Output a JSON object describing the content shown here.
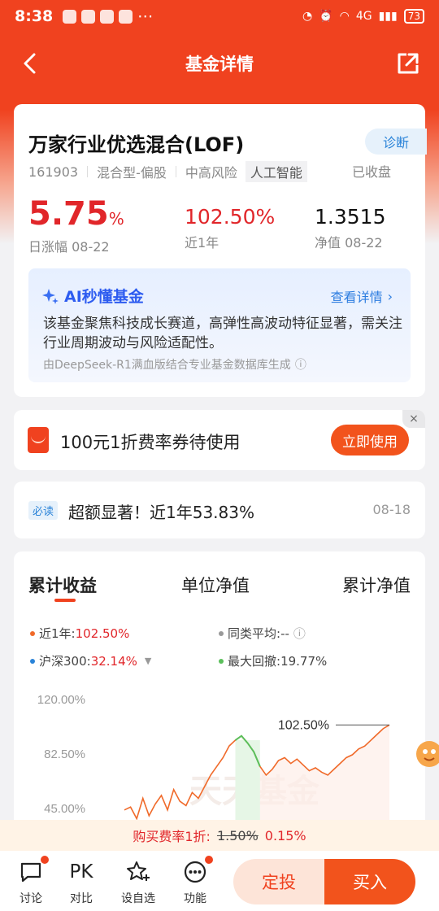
{
  "status_bar": {
    "time": "8:38",
    "network": "4G",
    "battery": "73"
  },
  "header": {
    "title": "基金详情"
  },
  "fund": {
    "name": "万家行业优选混合(LOF)",
    "diagnose_label": "诊断",
    "code": "161903",
    "type": "混合型-偏股",
    "risk": "中高风险",
    "theme": "人工智能",
    "market_status": "已收盘",
    "daily_change": "5.75",
    "daily_change_unit": "%",
    "daily_change_label": "日涨幅 08-22",
    "one_year_return": "102.50%",
    "one_year_label": "近1年",
    "nav": "1.3515",
    "nav_label": "净值 08-22"
  },
  "ai": {
    "title": "AI秒懂基金",
    "more": "查看详情",
    "description": "该基金聚焦科技成长赛道，高弹性高波动特征显著，需关注行业周期波动与风险适配性。",
    "source": "由DeepSeek-R1满血版结合专业基金数据库生成"
  },
  "coupon": {
    "text": "100元1折费率券待使用",
    "button": "立即使用",
    "close": "×"
  },
  "news": {
    "badge": "必读",
    "text": "超额显著！近1年53.83%",
    "date": "08-18"
  },
  "chart_tabs": [
    "累计收益",
    "单位净值",
    "累计净值"
  ],
  "legend": {
    "fund_label": "近1年:",
    "fund_value": "102.50%",
    "avg_label": "同类平均:",
    "avg_value": "--",
    "index_label": "沪深300:",
    "index_value": "32.14%",
    "drawdown_label": "最大回撤:",
    "drawdown_value": "19.77%"
  },
  "chart_data": {
    "type": "line",
    "y_ticks": [
      "120.00%",
      "82.50%",
      "45.00%"
    ],
    "ylim": [
      45.0,
      120.0
    ],
    "end_label": "102.50%",
    "watermark": "天天基金",
    "series": [
      {
        "name": "近1年",
        "color": "#f06a2a",
        "values": [
          44,
          46,
          38,
          52,
          40,
          48,
          54,
          44,
          58,
          50,
          47,
          56,
          52,
          60,
          68,
          74,
          80,
          88,
          92,
          95,
          90,
          84,
          74,
          68,
          72,
          78,
          80,
          76,
          79,
          75,
          71,
          73,
          70,
          68,
          72,
          76,
          80,
          82,
          86,
          88,
          92,
          96,
          100,
          102.5
        ]
      }
    ],
    "drawdown_segment": [
      18,
      22
    ]
  },
  "fee_bar": {
    "label": "购买费率1折:",
    "old": "1.50%",
    "new": "0.15%"
  },
  "bottom_nav": {
    "discuss": "讨论",
    "compare": "对比",
    "compare_icon": "PK",
    "watchlist": "设自选",
    "more": "功能",
    "dingtou": "定投",
    "buy": "买入"
  },
  "colors": {
    "brand": "#f0421f",
    "up": "#e1262a",
    "blue": "#2a83d8"
  }
}
